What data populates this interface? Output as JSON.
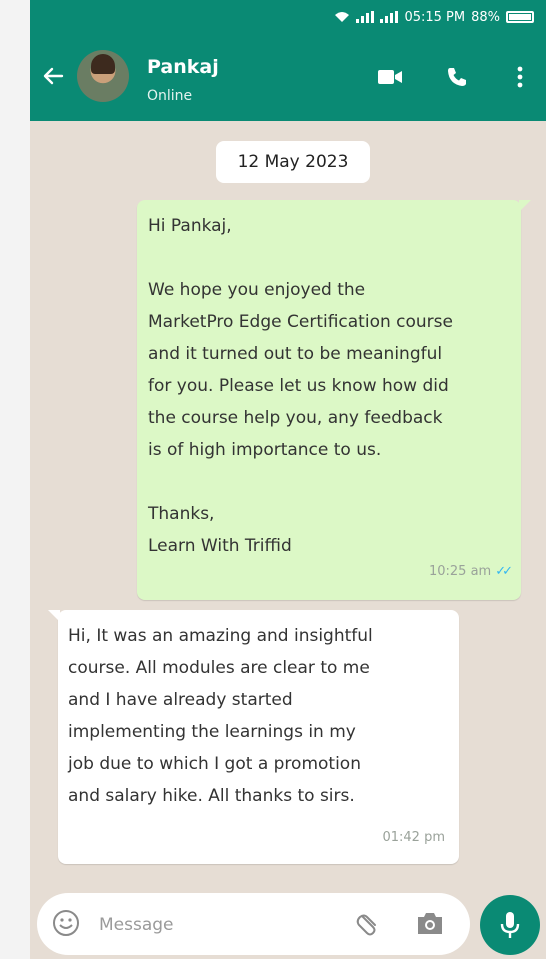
{
  "status_bar": {
    "time": "05:15 PM",
    "battery": "88%"
  },
  "header": {
    "contact_name": "Pankaj",
    "contact_status": "Online"
  },
  "chat": {
    "date": "12 May 2023",
    "messages": [
      {
        "direction": "outgoing",
        "text": "Hi Pankaj,\n\nWe hope you enjoyed the\nMarketPro Edge Certification course\nand it turned out to be meaningful\nfor you. Please let us know how did\nthe course help you, any feedback\nis of high importance to us.\n\nThanks,\nLearn With Triffid",
        "time": "10:25 am",
        "read": true
      },
      {
        "direction": "incoming",
        "text": " Hi, It was an amazing and insightful\ncourse. All modules are clear to me\nand I have already started\nimplementing the learnings in my\njob due to which I got a promotion\nand salary hike. All thanks to sirs.",
        "time": "01:42 pm"
      }
    ]
  },
  "composer": {
    "placeholder": "Message"
  },
  "colors": {
    "header": "#0a8a74",
    "outgoing_bubble": "#dcf8c6",
    "chat_bg": "#e6ddd4",
    "read_ticks": "#34b7f1"
  },
  "icons": [
    "wifi-icon",
    "signal-icon",
    "battery-icon",
    "back-arrow-icon",
    "video-call-icon",
    "phone-call-icon",
    "more-options-icon",
    "emoji-icon",
    "attach-icon",
    "camera-icon",
    "mic-icon",
    "double-check-icon"
  ]
}
